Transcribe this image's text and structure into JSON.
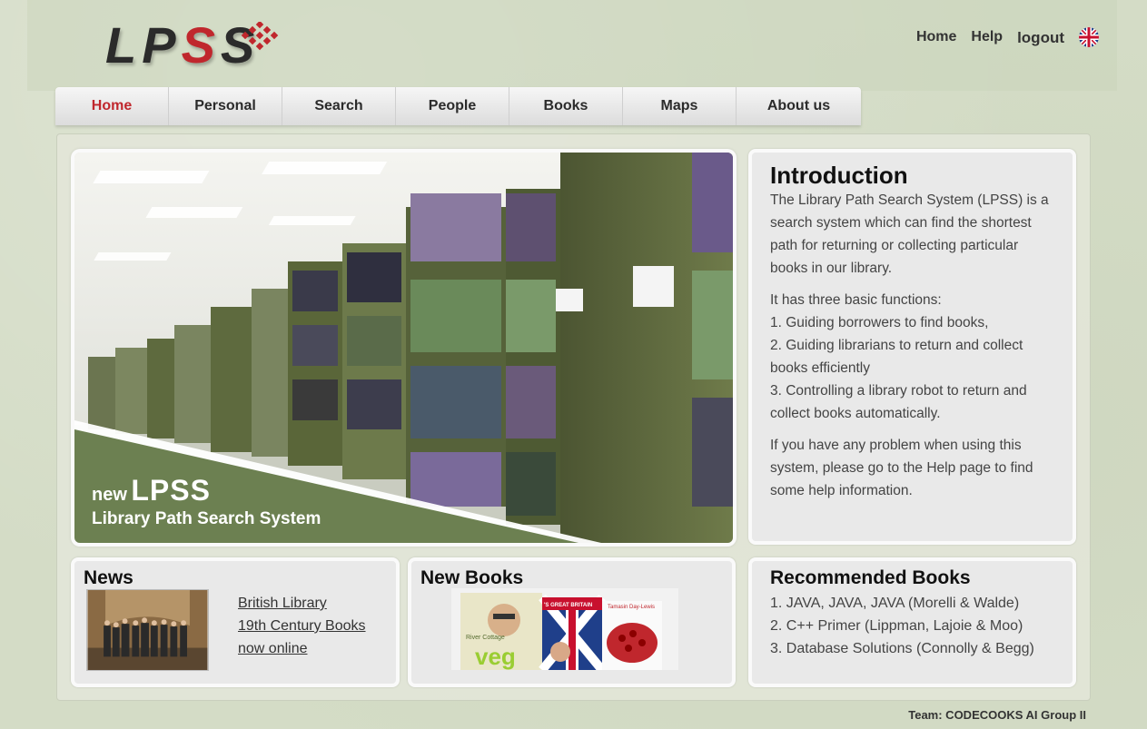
{
  "logo": {
    "part1": "LP",
    "part2": "S",
    "part3": "S"
  },
  "toplinks": {
    "home": "Home",
    "help": "Help",
    "logout": "logout"
  },
  "nav": [
    "Home",
    "Personal",
    "Search",
    "People",
    "Books",
    "Maps",
    "About us"
  ],
  "hero": {
    "new": "new",
    "title": "LPSS",
    "subtitle": "Library Path Search System"
  },
  "introduction": {
    "title": "Introduction",
    "p1": "The Library Path Search System (LPSS) is a search system which can find the shortest path for returning or collecting particular books in our library.",
    "p2": "It has three basic functions:",
    "f1": "1. Guiding borrowers to find books,",
    "f2": "2. Guiding librarians to return and collect books efficiently",
    "f3": "3. Controlling a library robot to return and collect books automatically.",
    "p3": "If you have any problem when using this system, please go to the Help page to find some help information."
  },
  "news": {
    "title": "News",
    "links": [
      "British Library",
      "19th Century Books",
      "now online"
    ]
  },
  "new_books": {
    "title": "New Books",
    "cover1_brand": "River Cottage",
    "cover1_title": "veg",
    "cover2_title": "'S GREAT BRITAIN",
    "cover3_author": "Tamasin Day-Lewis"
  },
  "recommended": {
    "title": "Recommended Books",
    "items": [
      "1. JAVA, JAVA, JAVA (Morelli & Walde)",
      "2. C++ Primer (Lippman, Lajoie & Moo)",
      "3. Database Solutions (Connolly & Begg)"
    ]
  },
  "footer": "Team: CODECOOKS AI Group II",
  "colors": {
    "accent": "#c0272d",
    "nav_text": "#2b2b2b",
    "panel_bg": "#e9e9e9",
    "shelf_green": "#5e6a3e"
  }
}
